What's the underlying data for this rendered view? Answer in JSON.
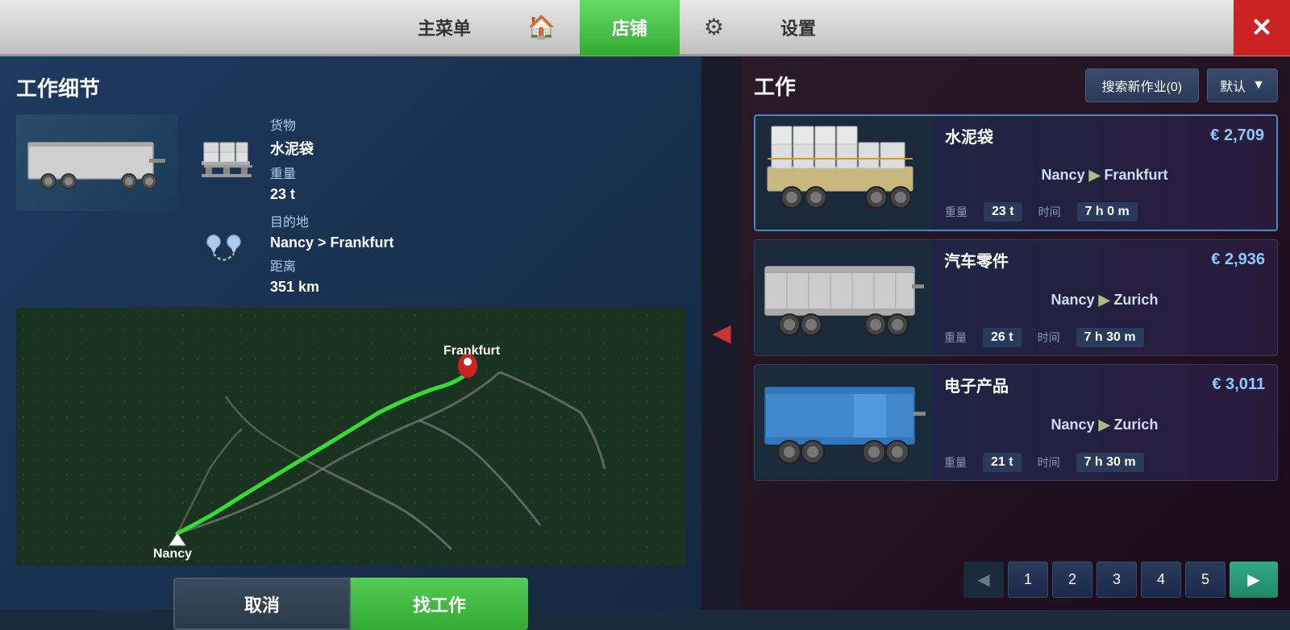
{
  "nav": {
    "main_menu": "主菜单",
    "home_icon": "🏠",
    "shop": "店铺",
    "settings_icon": "⚙",
    "settings": "设置",
    "close": "✕"
  },
  "left_panel": {
    "title": "工作细节",
    "cargo_label": "货物",
    "cargo_value": "水泥袋",
    "weight_label": "重量",
    "weight_value": "23 t",
    "destination_label": "目的地",
    "destination_value": "Nancy > Frankfurt",
    "distance_label": "距离",
    "distance_value": "351 km",
    "btn_cancel": "取消",
    "btn_find": "找工作",
    "map_from": "Nancy",
    "map_to": "Frankfurt"
  },
  "right_panel": {
    "title": "工作",
    "search_btn": "搜索新作业(0)",
    "default_label": "默认",
    "jobs": [
      {
        "cargo": "水泥袋",
        "price": "€ 2,709",
        "from": "Nancy",
        "to": "Frankfurt",
        "weight": "23 t",
        "time": "7 h 0 m",
        "weight_label": "重量",
        "time_label": "时间",
        "trailer_type": "flatbed",
        "active": true
      },
      {
        "cargo": "汽车零件",
        "price": "€ 2,936",
        "from": "Nancy",
        "to": "Zurich",
        "weight": "26 t",
        "time": "7 h 30 m",
        "weight_label": "重量",
        "time_label": "时间",
        "trailer_type": "curtain",
        "active": false
      },
      {
        "cargo": "电子产品",
        "price": "€ 3,011",
        "from": "Nancy",
        "to": "Zurich",
        "weight": "21 t",
        "time": "7 h 30 m",
        "weight_label": "重量",
        "time_label": "时间",
        "trailer_type": "blue_box",
        "active": false
      }
    ],
    "pagination": [
      "1",
      "2",
      "3",
      "4",
      "5"
    ]
  }
}
